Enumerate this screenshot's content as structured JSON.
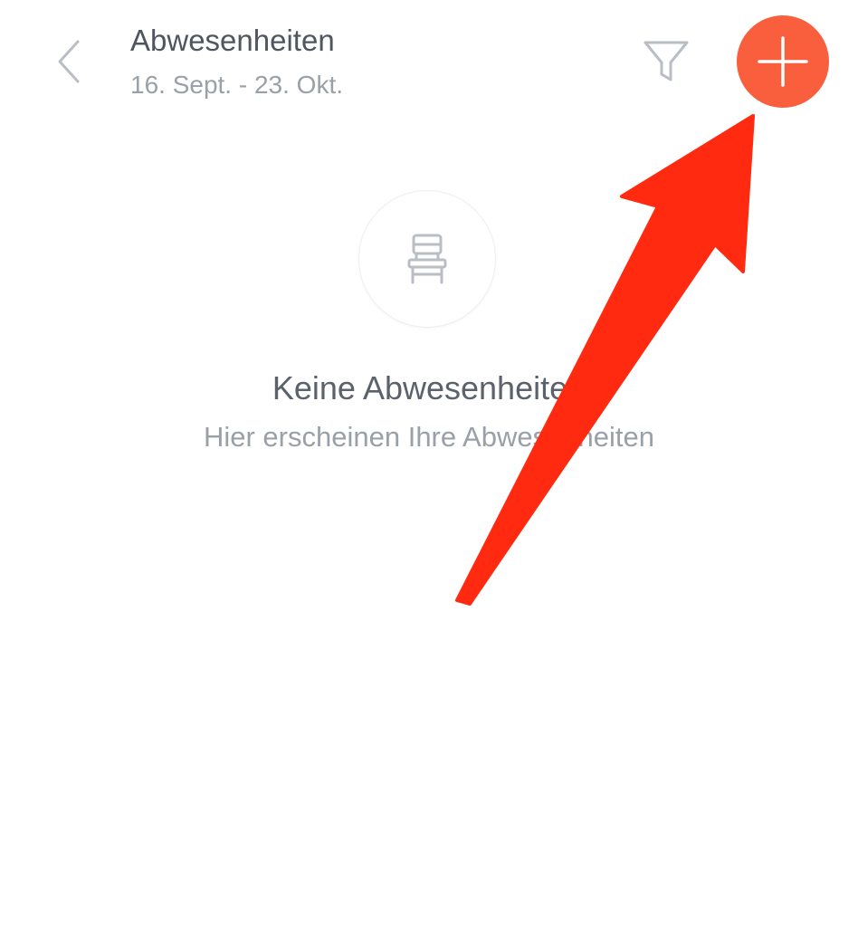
{
  "header": {
    "title": "Abwesenheiten",
    "date_range": "16. Sept. - 23. Okt."
  },
  "icons": {
    "back": "chevron-left-icon",
    "filter": "filter-funnel-icon",
    "add": "plus-icon",
    "empty_state": "chair-icon"
  },
  "empty_state": {
    "title": "Keine Abwesenheiten",
    "subtitle": "Hier erscheinen Ihre Abwesenheiten"
  },
  "annotation": {
    "type": "arrow",
    "points_to": "add-button"
  },
  "colors": {
    "accent": "#f95f3c",
    "arrow": "#ff2a10",
    "icon_gray": "#b9bec4",
    "title_text": "#4f5660",
    "muted_text": "#9aa0a8"
  }
}
